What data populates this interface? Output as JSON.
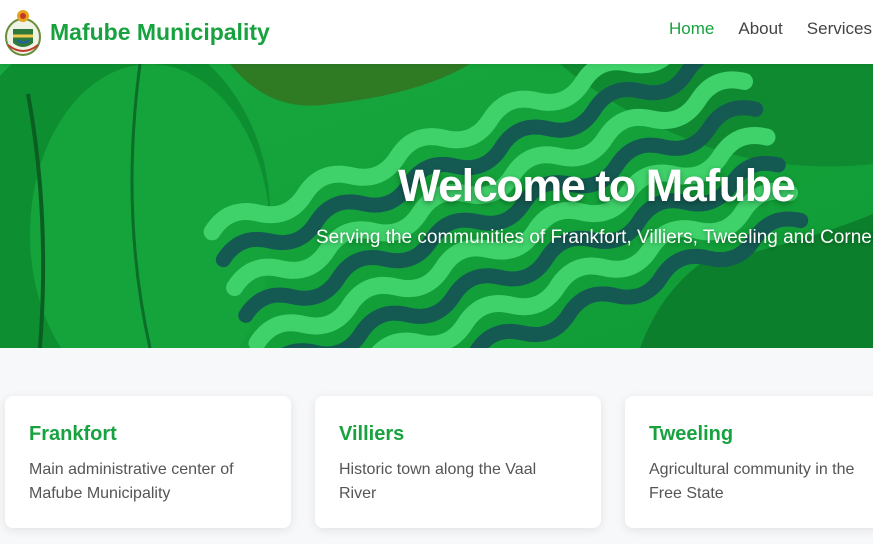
{
  "brand": {
    "name": "Mafube Municipality",
    "logo_icon": "municipal-coat-of-arms"
  },
  "nav": {
    "items": [
      {
        "label": "Home",
        "active": true
      },
      {
        "label": "About",
        "active": false
      },
      {
        "label": "Services",
        "active": false
      }
    ]
  },
  "hero": {
    "title": "Welcome to Mafube",
    "subtitle": "Serving the communities of Frankfort, Villiers, Tweeling and Cornelia"
  },
  "towns": [
    {
      "name": "Frankfort",
      "description": "Main administrative center of Mafube Municipality"
    },
    {
      "name": "Villiers",
      "description": "Historic town along the Vaal River"
    },
    {
      "name": "Tweeling",
      "description": "Agricultural community in the Free State"
    }
  ],
  "colors": {
    "brand_green": "#17a23f",
    "hero_green": "#13a13a",
    "wave_dark": "#145a52",
    "page_bg": "#f7f8fa"
  }
}
